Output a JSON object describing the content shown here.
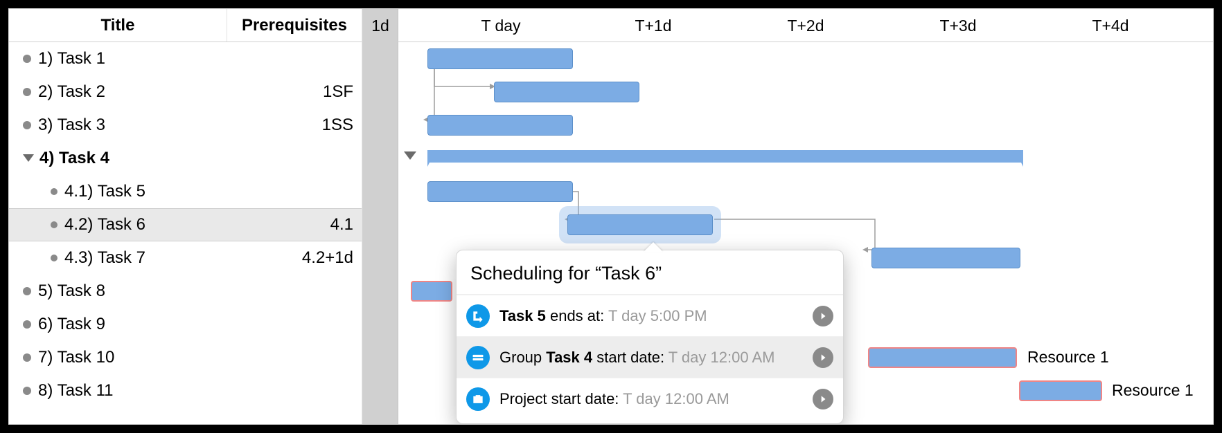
{
  "columns": {
    "title": "Title",
    "prereq": "Prerequisites"
  },
  "timeline": {
    "minor": "1d",
    "ticks": [
      "T day",
      "T+1d",
      "T+2d",
      "T+3d",
      "T+4d"
    ]
  },
  "rows": [
    {
      "num": "1)",
      "title": "Task 1",
      "prereq": "",
      "indent": 0,
      "group": false
    },
    {
      "num": "2)",
      "title": "Task 2",
      "prereq": "1SF",
      "indent": 0,
      "group": false
    },
    {
      "num": "3)",
      "title": "Task 3",
      "prereq": "1SS",
      "indent": 0,
      "group": false
    },
    {
      "num": "4)",
      "title": "Task 4",
      "prereq": "",
      "indent": 0,
      "group": true,
      "expanded": true
    },
    {
      "num": "4.1)",
      "title": "Task 5",
      "prereq": "",
      "indent": 1,
      "group": false
    },
    {
      "num": "4.2)",
      "title": "Task 6",
      "prereq": "4.1",
      "indent": 1,
      "group": false,
      "selected": true
    },
    {
      "num": "4.3)",
      "title": "Task 7",
      "prereq": "4.2+1d",
      "indent": 1,
      "group": false
    },
    {
      "num": "5)",
      "title": "Task 8",
      "prereq": "",
      "indent": 0,
      "group": false
    },
    {
      "num": "6)",
      "title": "Task 9",
      "prereq": "",
      "indent": 0,
      "group": false
    },
    {
      "num": "7)",
      "title": "Task 10",
      "prereq": "",
      "indent": 0,
      "group": false,
      "resource": "Resource 1"
    },
    {
      "num": "8)",
      "title": "Task 11",
      "prereq": "",
      "indent": 0,
      "group": false,
      "resource": "Resource 1"
    }
  ],
  "popover": {
    "title": "Scheduling for “Task 6”",
    "items": [
      {
        "prefix": "",
        "bold": "Task 5",
        "mid": " ends at: ",
        "value": "T day 5:00 PM",
        "icon": "dependency",
        "selected": false
      },
      {
        "prefix": "Group ",
        "bold": "Task 4",
        "mid": " start date: ",
        "value": "T day 12:00 AM",
        "icon": "group",
        "selected": true
      },
      {
        "prefix": "",
        "bold": "",
        "mid": "Project start date: ",
        "value": "T day 12:00 AM",
        "icon": "project",
        "selected": false
      }
    ]
  },
  "chart_data": {
    "type": "gantt",
    "time_unit": "days",
    "origin_label": "T day",
    "tasks": [
      {
        "id": "1",
        "name": "Task 1",
        "start": 0.0,
        "end": 1.0
      },
      {
        "id": "2",
        "name": "Task 2",
        "start": 0.5,
        "end": 1.5,
        "depends_on": [
          {
            "task": "1",
            "type": "SF"
          }
        ]
      },
      {
        "id": "3",
        "name": "Task 3",
        "start": 0.0,
        "end": 1.0,
        "depends_on": [
          {
            "task": "1",
            "type": "SS"
          }
        ]
      },
      {
        "id": "4",
        "name": "Task 4",
        "start": 0.0,
        "end": 4.0,
        "summary": true,
        "children": [
          "4.1",
          "4.2",
          "4.3"
        ]
      },
      {
        "id": "4.1",
        "name": "Task 5",
        "start": 0.0,
        "end": 1.0
      },
      {
        "id": "4.2",
        "name": "Task 6",
        "start": 1.0,
        "end": 2.0,
        "depends_on": [
          {
            "task": "4.1",
            "type": "FS"
          }
        ]
      },
      {
        "id": "4.3",
        "name": "Task 7",
        "start": 3.0,
        "end": 4.0,
        "depends_on": [
          {
            "task": "4.2",
            "type": "FS",
            "lag_days": 1
          }
        ]
      },
      {
        "id": "5",
        "name": "Task 8",
        "start": -0.2,
        "end": 0.2
      },
      {
        "id": "7",
        "name": "Task 10",
        "start": 3.0,
        "end": 4.0,
        "resource": "Resource 1"
      },
      {
        "id": "8",
        "name": "Task 11",
        "start": 4.0,
        "end": 4.6,
        "resource": "Resource 1"
      }
    ]
  }
}
